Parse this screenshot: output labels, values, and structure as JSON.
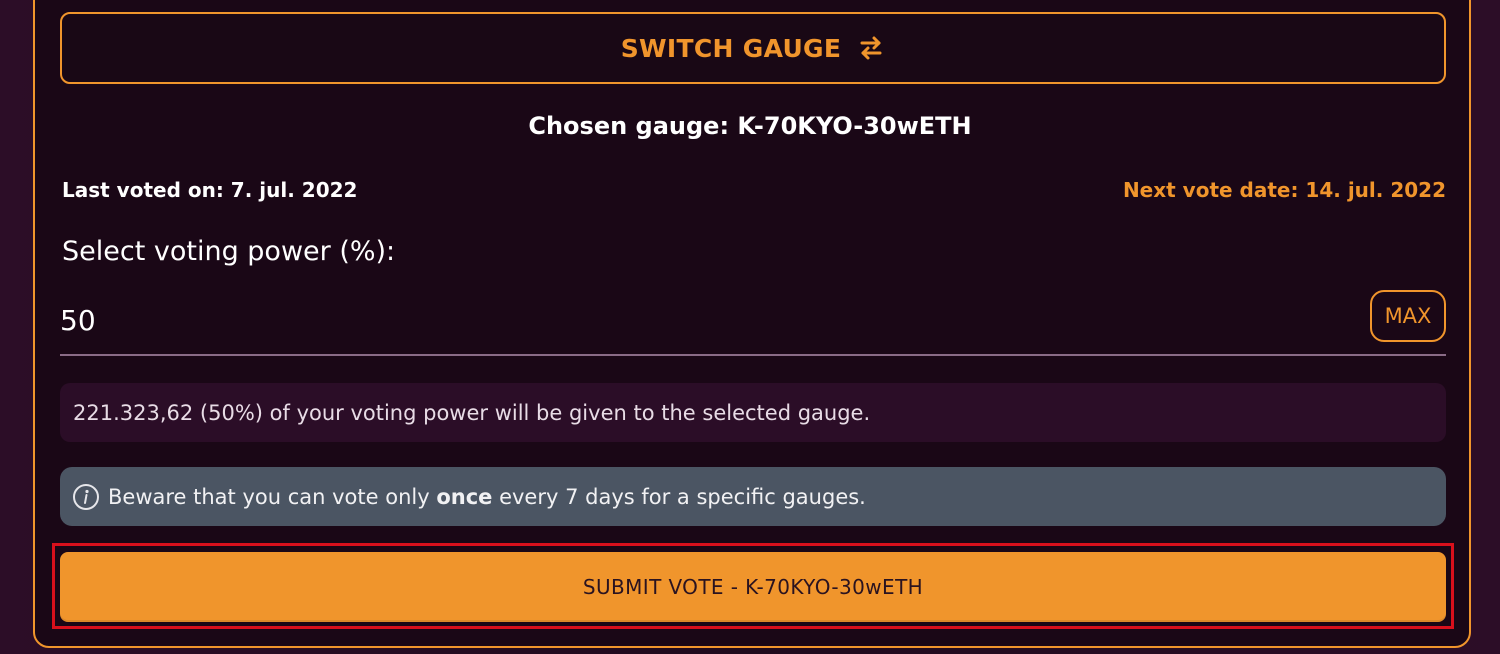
{
  "switch_gauge": {
    "label": "SWITCH GAUGE",
    "icon": "swap-arrows-icon"
  },
  "chosen_gauge": "Chosen gauge: K-70KYO-30wETH",
  "last_voted": "Last voted on: 7. jul. 2022",
  "next_vote": "Next vote date: 14. jul. 2022",
  "voting_power": {
    "label": "Select voting power (%):",
    "value": "50",
    "max_label": "MAX"
  },
  "summary_text": "221.323,62 (50%) of your voting power will be given to the selected gauge.",
  "warning": {
    "icon": "info-icon",
    "before": "Beware that you can vote only ",
    "emphasis": "once",
    "after": " every 7 days for a specific gauges."
  },
  "submit_label": "SUBMIT VOTE - K-70KYO-30wETH",
  "colors": {
    "accent": "#f0952c",
    "panel_bg": "#1a0716",
    "warning_bg": "#4b5563",
    "highlight": "#d9101c"
  }
}
